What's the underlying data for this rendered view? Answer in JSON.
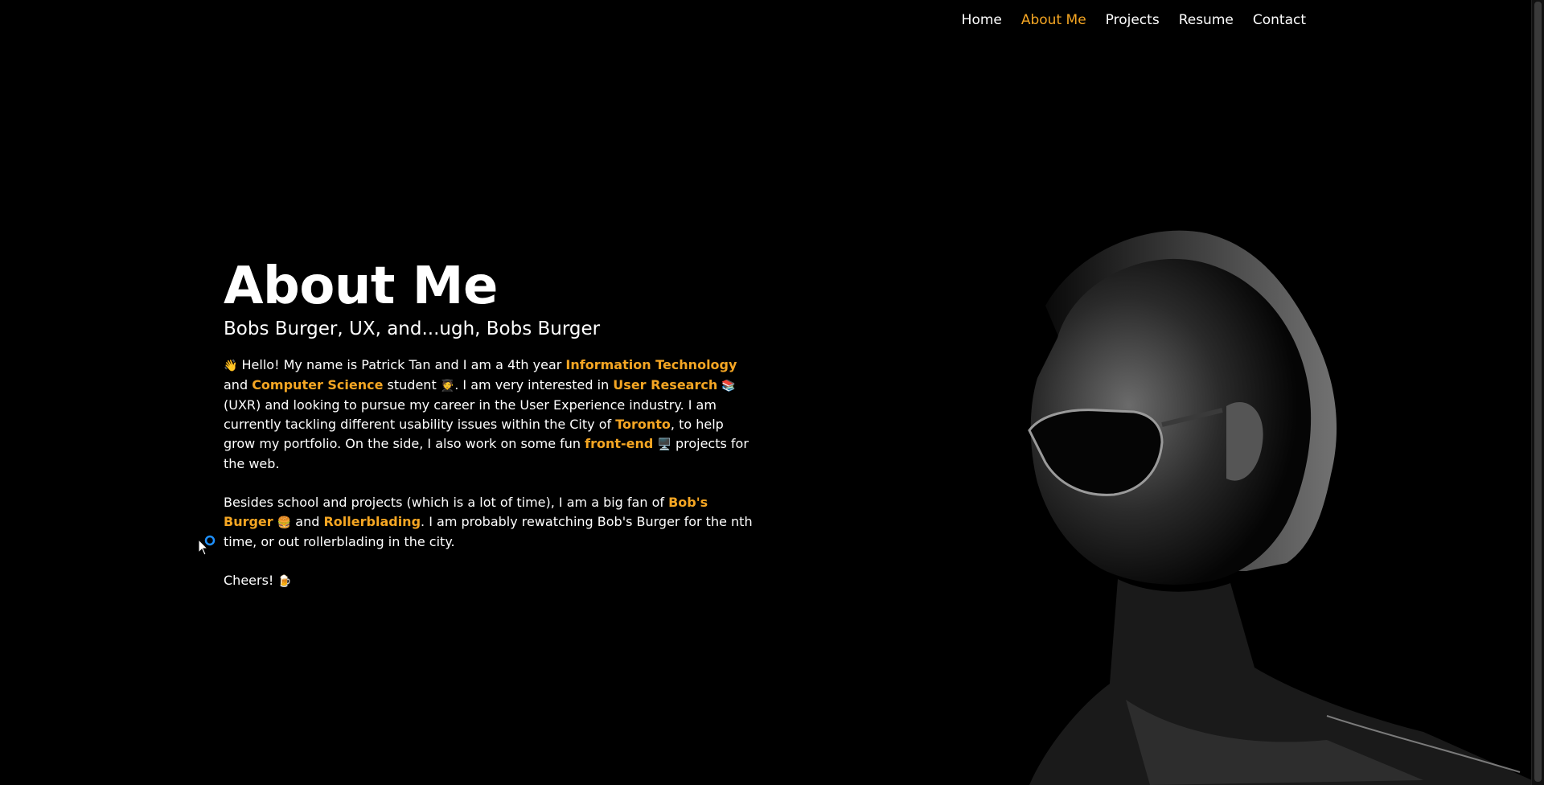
{
  "nav": {
    "items": [
      "Home",
      "About Me",
      "Projects",
      "Resume",
      "Contact"
    ],
    "active": "About Me"
  },
  "hero": {
    "title": "About Me",
    "subtitle": "Bobs Burger, UX, and...ugh, Bobs Burger"
  },
  "paragraph1": {
    "wave_emoji": "👋",
    "t1": " Hello! My name is Patrick Tan and I am a 4th year ",
    "h1": "Information Technology",
    "t2": " and ",
    "h2": "Computer Science",
    "t3": " student ",
    "student_emoji": "🧑‍🎓",
    "t4": ". I am very interested in ",
    "h3": "User Research",
    "books_emoji": "📚",
    "t5": " (UXR) and looking to pursue my career in the User Experience industry. I am currently tackling different usability issues within the City of ",
    "h4": "Toronto",
    "t6": ", to help grow my portfolio. On the side, I also work on some fun ",
    "h5": "front-end",
    "computer_emoji": "🖥️",
    "t7": " projects for the web."
  },
  "paragraph2": {
    "t1": "Besides school and projects (which is a lot of time), I am a big fan of ",
    "h1": "Bob's Burger",
    "burger_emoji": "🍔",
    "t2": " and ",
    "h2": "Rollerblading",
    "t3": ". I am probably rewatching Bob's Burger for the nth time, or out rollerblading in the city."
  },
  "paragraph3": {
    "t1": "Cheers! ",
    "beer_emoji": "🍺"
  },
  "colors": {
    "background": "#000000",
    "text": "#ffffff",
    "accent": "#f5a623"
  },
  "icons": {
    "cursor": "busy-pointer-icon",
    "portrait": "portrait-photo"
  }
}
